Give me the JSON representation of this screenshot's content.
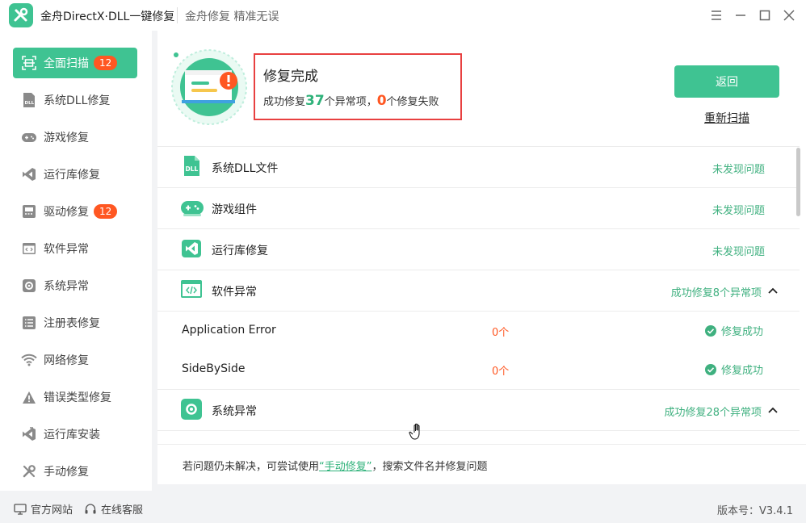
{
  "window": {
    "title": "金舟DirectX·DLL一键修复",
    "slogan": "金舟修复 精准无误"
  },
  "sidebar": {
    "items": [
      {
        "label": "全面扫描",
        "badge": "12",
        "active": true,
        "icon": "scan-icon"
      },
      {
        "label": "系统DLL修复",
        "icon": "dll-icon"
      },
      {
        "label": "游戏修复",
        "icon": "gamepad-icon"
      },
      {
        "label": "运行库修复",
        "icon": "vs-icon"
      },
      {
        "label": "驱动修复",
        "badge": "12",
        "icon": "driver-icon"
      },
      {
        "label": "软件异常",
        "icon": "code-window-icon"
      },
      {
        "label": "系统异常",
        "icon": "gear-icon"
      },
      {
        "label": "注册表修复",
        "icon": "list-icon"
      },
      {
        "label": "网络修复",
        "icon": "wifi-icon"
      },
      {
        "label": "错误类型修复",
        "icon": "warning-icon"
      },
      {
        "label": "运行库安装",
        "icon": "vs-install-icon"
      },
      {
        "label": "手动修复",
        "icon": "wrench-icon"
      }
    ]
  },
  "footer": {
    "website": "官方网站",
    "support": "在线客服",
    "version": "版本号：V3.4.1"
  },
  "result": {
    "title": "修复完成",
    "prefix": "成功修复",
    "fixed_count": "37",
    "mid": "个异常项，",
    "failed_count": "0",
    "suffix": "个修复失败",
    "back_label": "返回",
    "rescan_label": "重新扫描"
  },
  "list": {
    "rows": [
      {
        "label": "系统DLL文件",
        "status": "未发现问题"
      },
      {
        "label": "游戏组件",
        "status": "未发现问题"
      },
      {
        "label": "运行库修复",
        "status": "未发现问题"
      },
      {
        "label": "软件异常",
        "status": "成功修复8个异常项"
      },
      {
        "label": "系统异常",
        "status": "成功修复28个异常项"
      }
    ],
    "sub_rows": [
      {
        "name": "Application Error",
        "count": "0个",
        "status": "修复成功"
      },
      {
        "name": "SideBySide",
        "count": "0个",
        "status": "修复成功"
      }
    ]
  },
  "hint": {
    "before": "若问题仍未解决，可尝试使用",
    "link": "“手动修复”",
    "after": "，搜索文件名并修复问题"
  },
  "colors": {
    "accent": "#3fc392",
    "orange": "#ff5722",
    "status_green": "#3fb07f",
    "highlight_border": "#e84040"
  }
}
